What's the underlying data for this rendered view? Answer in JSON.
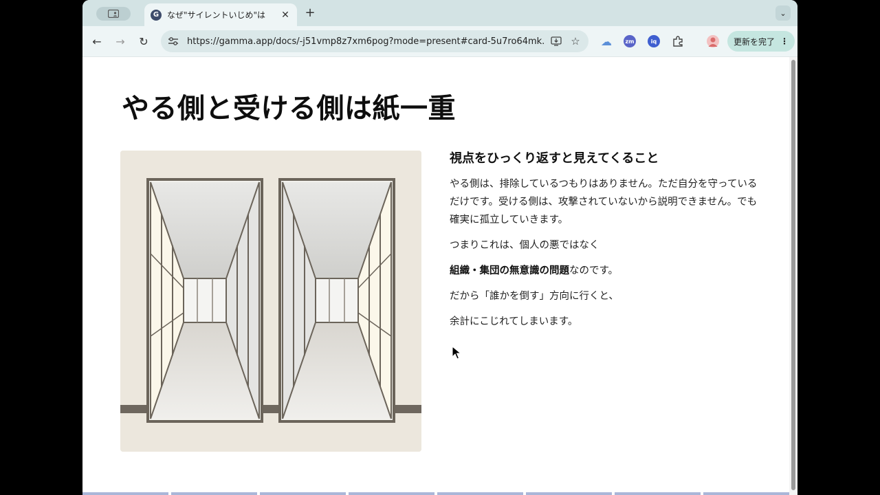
{
  "browser": {
    "tab_title": "なぜ\"サイレントいじめ\"は",
    "tab_favicon_letter": "G",
    "new_tab_symbol": "+",
    "url": "https://gamma.app/docs/-j51vmp8z7xm6pog?mode=present#card-5u7ro64mk...",
    "update_button": "更新を完了",
    "extensions": [
      {
        "name": "cloud-icon",
        "label": "",
        "color": "#5b8fd8"
      },
      {
        "name": "zoom-icon",
        "label": "zm",
        "color": "#5964c8"
      },
      {
        "name": "extension-blue-icon",
        "label": "iq",
        "color": "#3f5fd0"
      }
    ]
  },
  "slide": {
    "title": "やる側と受ける側は紙一重",
    "subtitle": "視点をひっくり返すと見えてくること",
    "paragraph1": "やる側は、排除しているつもりはありません。ただ自分を守っているだけです。受ける側は、攻撃されていないから説明できません。でも確実に孤立していきます。",
    "paragraph2": "つまりこれは、個人の悪ではなく",
    "paragraph3_bold": "組織・集団の無意識の問題",
    "paragraph3_rest": "なのです。",
    "paragraph4": "だから「誰かを倒す」方向に行くと、",
    "paragraph5": "余計にこじれてしまいます。"
  },
  "progress": {
    "total_segments": 8,
    "completed_segments": 8
  }
}
